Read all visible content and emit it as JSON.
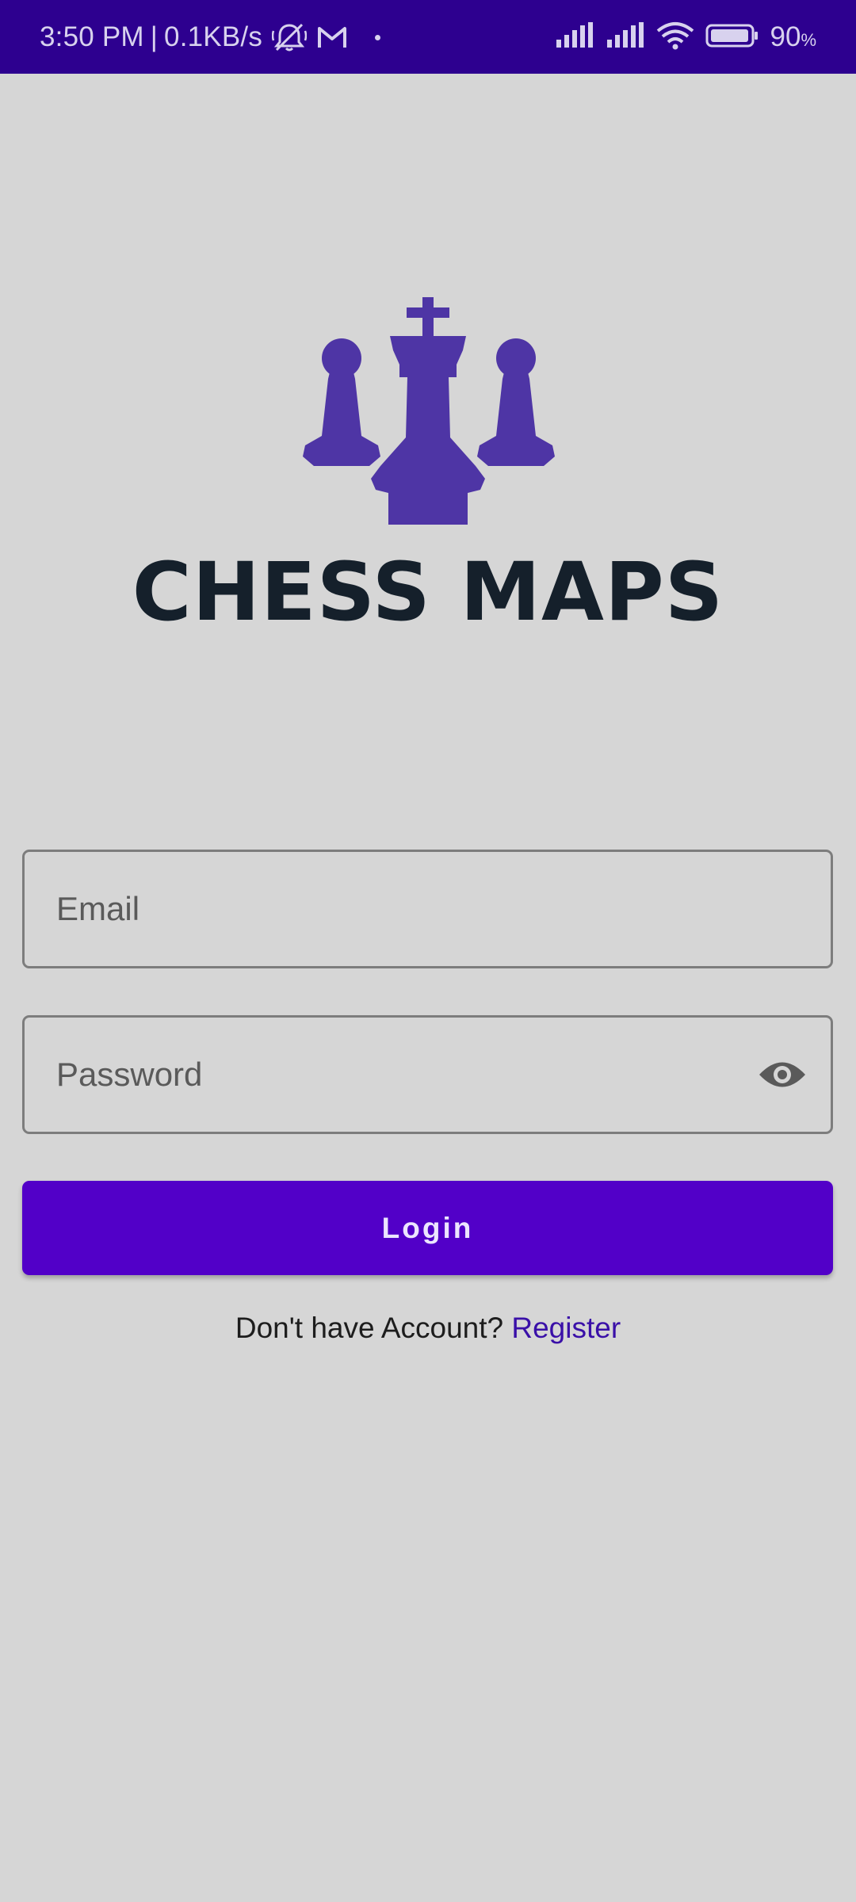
{
  "status_bar": {
    "time": "3:50 PM",
    "separator": "|",
    "network_speed": "0.1KB/s",
    "battery_percent": "90",
    "battery_unit": "%",
    "icons": [
      "mute-icon",
      "gmail-icon",
      "notification-dot",
      "signal-icon",
      "signal-icon",
      "wifi-icon",
      "battery-icon"
    ]
  },
  "brand": {
    "name": "CHESS MAPS",
    "logo_color": "#4e35a5"
  },
  "form": {
    "email_placeholder": "Email",
    "password_placeholder": "Password",
    "login_label": "Login"
  },
  "register": {
    "prompt": "Don't have Account?",
    "link_label": "Register"
  },
  "colors": {
    "status_bar": "#2d008f",
    "primary": "#5200c8",
    "link": "#3a10a8",
    "background": "#d6d6d6"
  }
}
